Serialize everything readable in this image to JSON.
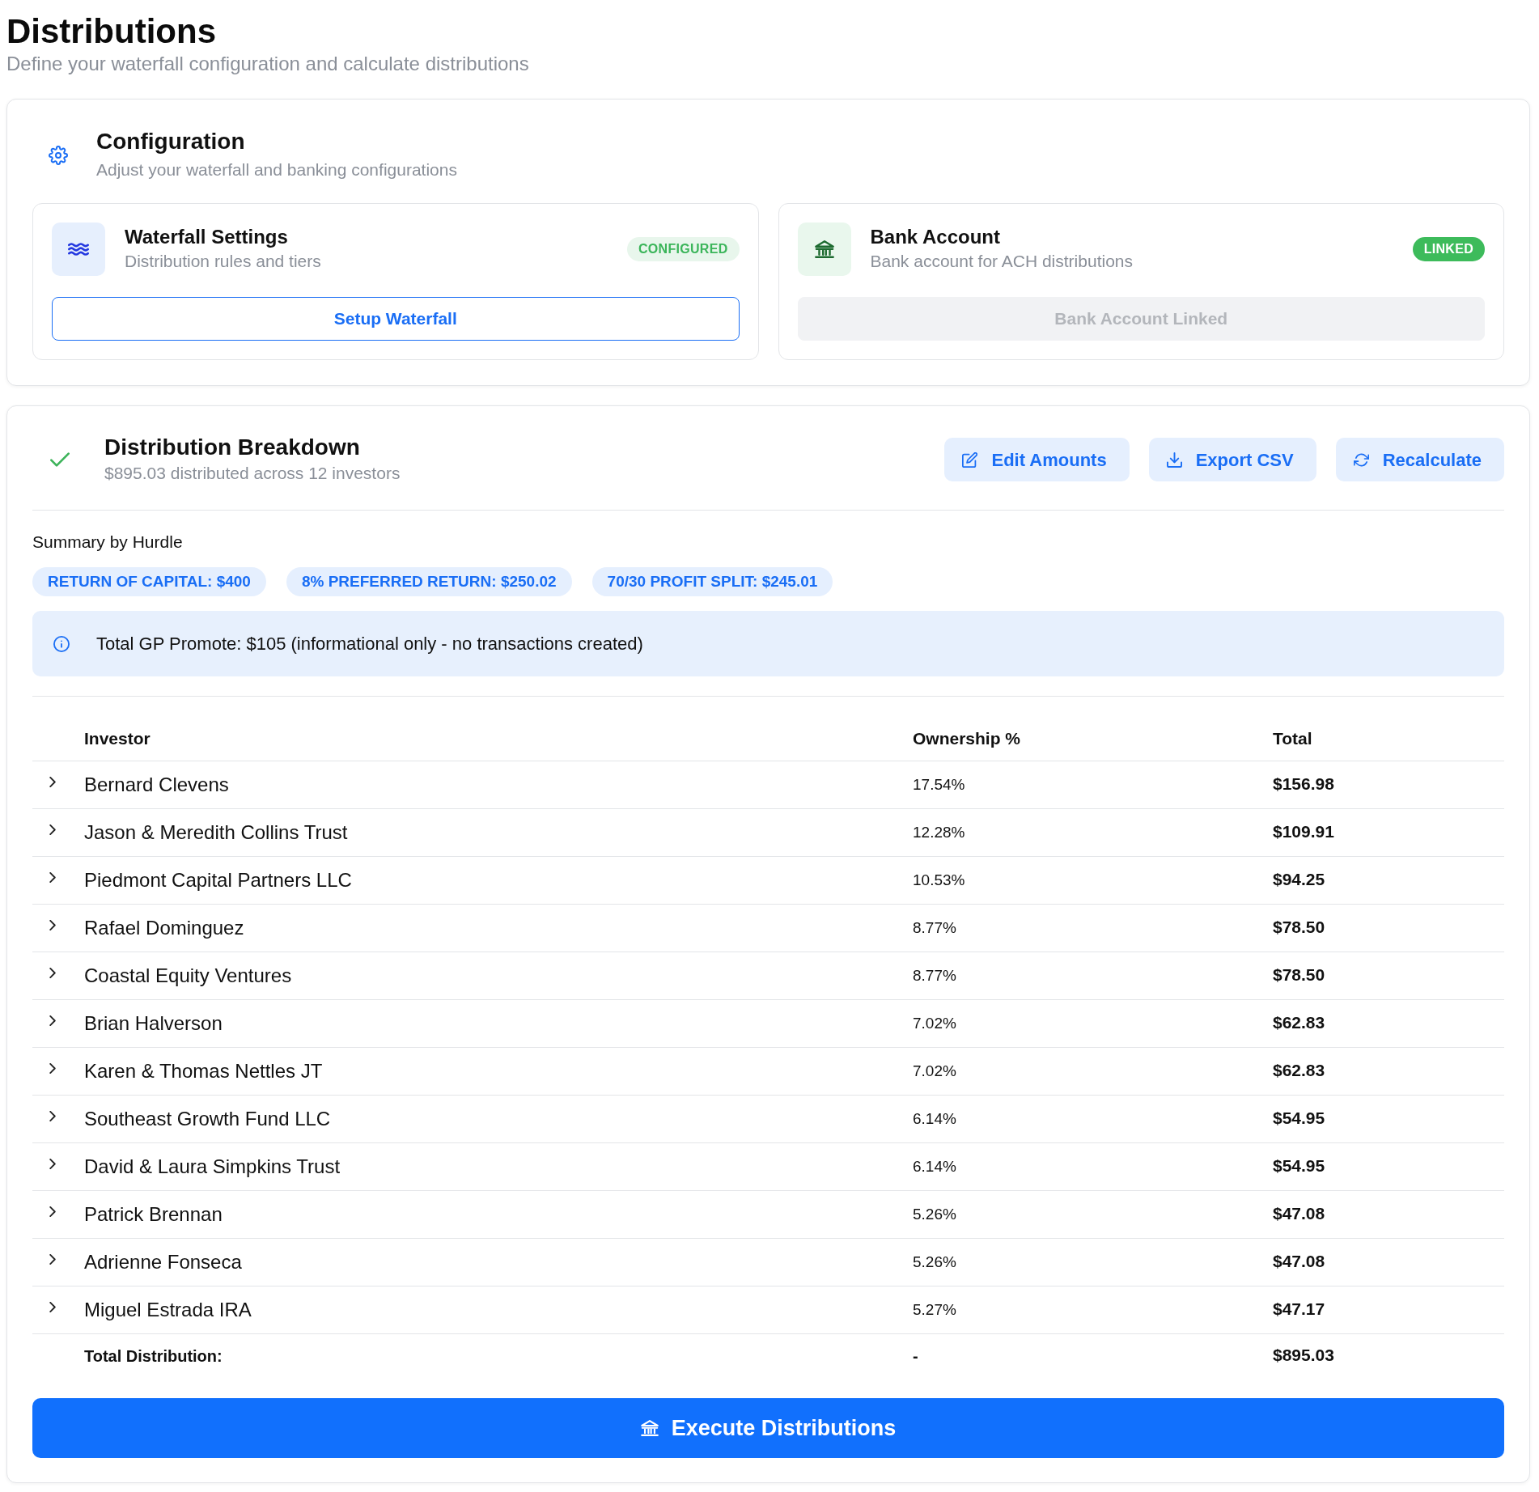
{
  "page": {
    "title": "Distributions",
    "subtitle": "Define your waterfall configuration and calculate distributions"
  },
  "configuration": {
    "title": "Configuration",
    "subtitle": "Adjust your waterfall and banking configurations",
    "panels": [
      {
        "kind": "waterfall",
        "title": "Waterfall Settings",
        "subtitle": "Distribution rules and tiers",
        "badge": {
          "kind": "soft",
          "label": "CONFIGURED"
        },
        "button": {
          "label": "Setup Waterfall",
          "disabled": false
        }
      },
      {
        "kind": "bank",
        "title": "Bank Account",
        "subtitle": "Bank account for ACH distributions",
        "badge": {
          "kind": "solid",
          "label": "LINKED"
        },
        "button": {
          "label": "Bank Account Linked",
          "disabled": true
        }
      }
    ]
  },
  "breakdown": {
    "title": "Distribution Breakdown",
    "subtitle": "$895.03 distributed across 12 investors",
    "actions": [
      {
        "kind": "edit",
        "label": "Edit Amounts"
      },
      {
        "kind": "export",
        "label": "Export CSV"
      },
      {
        "kind": "recalculate",
        "label": "Recalculate"
      }
    ],
    "summary_title": "Summary by Hurdle",
    "hurdles": [
      "RETURN OF CAPITAL: $400",
      "8% PREFERRED RETURN: $250.02",
      "70/30 PROFIT SPLIT: $245.01"
    ],
    "notice": "Total GP Promote: $105 (informational only - no transactions created)",
    "table": {
      "columns": [
        "Investor",
        "Ownership %",
        "Total"
      ],
      "rows": [
        {
          "investor": "Bernard Clevens",
          "ownership": "17.54%",
          "total": "$156.98",
          "expanded": false
        },
        {
          "investor": "Jason & Meredith Collins Trust",
          "ownership": "12.28%",
          "total": "$109.91",
          "expanded": false
        },
        {
          "investor": "Piedmont Capital Partners LLC",
          "ownership": "10.53%",
          "total": "$94.25",
          "expanded": false
        },
        {
          "investor": "Rafael Dominguez",
          "ownership": "8.77%",
          "total": "$78.50",
          "expanded": false
        },
        {
          "investor": "Coastal Equity Ventures",
          "ownership": "8.77%",
          "total": "$78.50",
          "expanded": false
        },
        {
          "investor": "Brian Halverson",
          "ownership": "7.02%",
          "total": "$62.83",
          "expanded": false
        },
        {
          "investor": "Karen & Thomas Nettles JT",
          "ownership": "7.02%",
          "total": "$62.83",
          "expanded": false
        },
        {
          "investor": "Southeast Growth Fund LLC",
          "ownership": "6.14%",
          "total": "$54.95",
          "expanded": false
        },
        {
          "investor": "David & Laura Simpkins Trust",
          "ownership": "6.14%",
          "total": "$54.95",
          "expanded": false
        },
        {
          "investor": "Patrick Brennan",
          "ownership": "5.26%",
          "total": "$47.08",
          "expanded": false
        },
        {
          "investor": "Adrienne Fonseca",
          "ownership": "5.26%",
          "total": "$47.08",
          "expanded": false
        },
        {
          "investor": "Miguel Estrada IRA",
          "ownership": "5.27%",
          "total": "$47.17",
          "expanded": false
        }
      ],
      "footer": {
        "label": "Total Distribution:",
        "ownership": "-",
        "total": "$895.03"
      }
    },
    "execute_button": {
      "label": "Execute Distributions"
    }
  }
}
